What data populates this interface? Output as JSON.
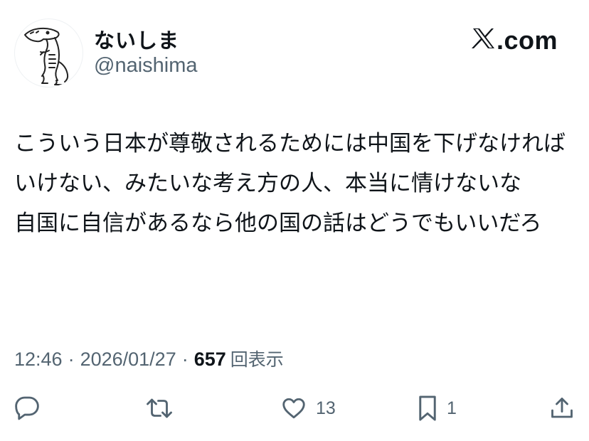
{
  "user": {
    "display_name": "ないしま",
    "handle": "@naishima"
  },
  "brand": {
    "label": ".com",
    "logo_icon": "x-logo-icon"
  },
  "tweet": {
    "text": "こういう日本が尊敬されるためには中国を下げなければいけない、みたいな考え方の人、本当に情けないな\n自国に自信があるなら他の国の話はどうでもいいだろ"
  },
  "meta": {
    "time": "12:46",
    "separator": "·",
    "date": "2026/01/27",
    "views_count": "657",
    "views_label": "回表示"
  },
  "actions": {
    "reply_icon": "reply-icon",
    "retweet_icon": "retweet-icon",
    "like_icon": "heart-icon",
    "like_count": "13",
    "bookmark_icon": "bookmark-icon",
    "bookmark_count": "1",
    "share_icon": "share-icon"
  },
  "colors": {
    "text_primary": "#0f1419",
    "text_secondary": "#536471",
    "background": "#ffffff"
  }
}
